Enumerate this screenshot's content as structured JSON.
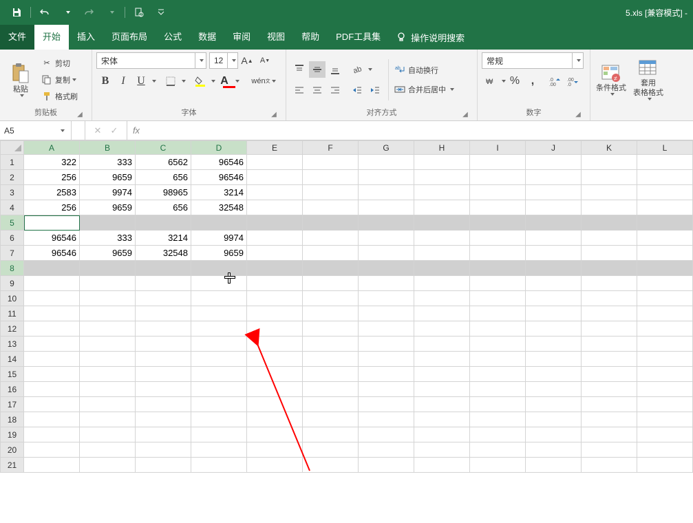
{
  "title": "5.xls  [兼容模式]  -",
  "tabs": {
    "file": "文件",
    "home": "开始",
    "insert": "插入",
    "layout": "页面布局",
    "formula": "公式",
    "data": "数据",
    "review": "审阅",
    "view": "视图",
    "help": "帮助",
    "pdf": "PDF工具集",
    "tell": "操作说明搜索"
  },
  "clipboard": {
    "paste": "粘贴",
    "cut": "剪切",
    "copy": "复制",
    "painter": "格式刷",
    "label": "剪贴板"
  },
  "font": {
    "name": "宋体",
    "size": "12",
    "label": "字体"
  },
  "align": {
    "wrap": "自动换行",
    "merge": "合并后居中",
    "label": "对齐方式"
  },
  "number": {
    "format": "常规",
    "label": "数字"
  },
  "styles": {
    "cond": "条件格式",
    "table": "套用\n表格格式"
  },
  "namebox": "A5",
  "columns": [
    "A",
    "B",
    "C",
    "D",
    "E",
    "F",
    "G",
    "H",
    "I",
    "J",
    "K",
    "L"
  ],
  "rows": [
    "1",
    "2",
    "3",
    "4",
    "5",
    "6",
    "7",
    "8",
    "9",
    "10",
    "11",
    "12",
    "13",
    "14",
    "15",
    "16",
    "17",
    "18",
    "19",
    "20",
    "21"
  ],
  "selected_rows": [
    5,
    8
  ],
  "active_cell_row": 5,
  "chart_data": {
    "type": "table",
    "columns": [
      "A",
      "B",
      "C",
      "D"
    ],
    "cells": {
      "1": {
        "A": "322",
        "B": "333",
        "C": "6562",
        "D": "96546"
      },
      "2": {
        "A": "256",
        "B": "9659",
        "C": "656",
        "D": "96546"
      },
      "3": {
        "A": "2583",
        "B": "9974",
        "C": "98965",
        "D": "3214"
      },
      "4": {
        "A": "256",
        "B": "9659",
        "C": "656",
        "D": "32548"
      },
      "6": {
        "A": "96546",
        "B": "333",
        "C": "3214",
        "D": "9974"
      },
      "7": {
        "A": "96546",
        "B": "9659",
        "C": "32548",
        "D": "9659"
      }
    }
  }
}
